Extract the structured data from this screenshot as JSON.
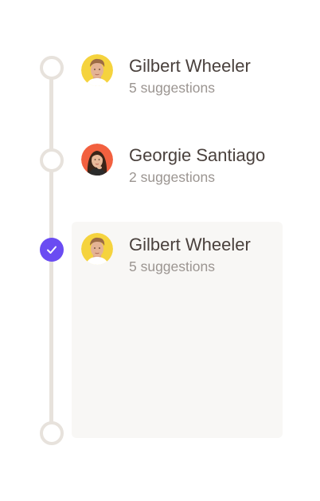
{
  "timeline": {
    "items": [
      {
        "name": "Gilbert Wheeler",
        "suggestions": "5 suggestions",
        "avatar_color": "#f5d33e",
        "checked": false
      },
      {
        "name": "Georgie Santiago",
        "suggestions": "2 suggestions",
        "avatar_color": "#f2603f",
        "checked": false
      },
      {
        "name": "Gilbert Wheeler",
        "suggestions": "5 suggestions",
        "avatar_color": "#f5d33e",
        "checked": true
      }
    ],
    "end_node": {
      "checked": false
    }
  },
  "colors": {
    "accent": "#6a4cf2",
    "track": "#e7e2dc",
    "card_bg": "#f8f7f5",
    "name_text": "#4a413d",
    "subtitle_text": "#9b9591"
  },
  "icons": {
    "check": "check-icon",
    "avatar_male": "male-person-avatar",
    "avatar_female": "female-person-avatar"
  }
}
